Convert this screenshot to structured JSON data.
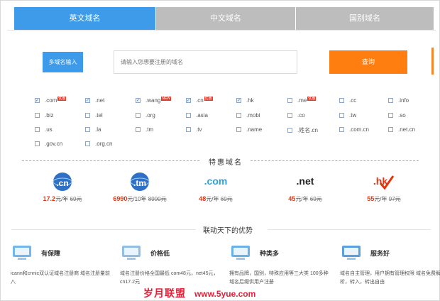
{
  "tabs": [
    "英文域名",
    "中文域名",
    "国别域名"
  ],
  "search": {
    "multi_label": "多域名输入",
    "placeholder": "请输入您想要注册的域名",
    "submit_label": "查询"
  },
  "domains": [
    {
      "label": ".com",
      "checked": true,
      "tag": "优惠"
    },
    {
      "label": ".net",
      "checked": true
    },
    {
      "label": ".wang",
      "checked": true,
      "tag": "NEW"
    },
    {
      "label": ".cn",
      "checked": true,
      "tag": "优惠"
    },
    {
      "label": ".hk",
      "checked": true
    },
    {
      "label": ".me",
      "checked": false,
      "tag": "优惠"
    },
    {
      "label": ".cc",
      "checked": false
    },
    {
      "label": ".info",
      "checked": false
    },
    {
      "label": ".biz",
      "checked": false
    },
    {
      "label": ".tel",
      "checked": false
    },
    {
      "label": ".org",
      "checked": false
    },
    {
      "label": ".asia",
      "checked": false
    },
    {
      "label": ".mobi",
      "checked": false
    },
    {
      "label": ".co",
      "checked": false
    },
    {
      "label": ".tw",
      "checked": false
    },
    {
      "label": ".so",
      "checked": false
    },
    {
      "label": ".us",
      "checked": false
    },
    {
      "label": ".la",
      "checked": false
    },
    {
      "label": ".tm",
      "checked": false
    },
    {
      "label": ".tv",
      "checked": false
    },
    {
      "label": ".name",
      "checked": false
    },
    {
      "label": ".姓名.cn",
      "checked": false
    },
    {
      "label": ".com.cn",
      "checked": false
    },
    {
      "label": ".net.cn",
      "checked": false
    },
    {
      "label": ".gov.cn",
      "checked": false
    },
    {
      "label": ".org.cn",
      "checked": false
    }
  ],
  "promo": {
    "title": "特惠域名",
    "items": [
      {
        "logo": ".cn",
        "price": "17.2",
        "unit": "元/年",
        "old": "69元",
        "color": "#2f6fc6"
      },
      {
        "logo": ".tm",
        "price": "6990",
        "unit": "元/10年",
        "old": "8990元",
        "color": "#2f6fc6"
      },
      {
        "logo": ".com",
        "price": "48",
        "unit": "元/年",
        "old": "69元",
        "color": "#29a0e0"
      },
      {
        "logo": ".net",
        "price": "45",
        "unit": "元/年",
        "old": "69元",
        "color": "#222222"
      },
      {
        "logo": ".hk",
        "price": "55",
        "unit": "元/年",
        "old": "97元",
        "color": "#e2350f"
      }
    ]
  },
  "advantages": {
    "title": "联动天下的优势",
    "items": [
      {
        "title": "有保障",
        "desc": "icann和cnnic双认证域名注册商 域名注册量前八",
        "icon": "security-icon"
      },
      {
        "title": "价格低",
        "desc": "域名注册价格全国最低 com48元，net45元，cn17.2元",
        "icon": "price-icon"
      },
      {
        "title": "种类多",
        "desc": "拥有品牌，国别，特殊应用等三大类 100多种域名后缀供用户注册",
        "icon": "variety-icon"
      },
      {
        "title": "服务好",
        "desc": "域名自主管理，用户拥有管理权限 域名免费解析，转入，转出自由",
        "icon": "service-icon"
      }
    ]
  },
  "watermark": {
    "cn": "岁月联盟",
    "url": "www.5yue.com"
  }
}
